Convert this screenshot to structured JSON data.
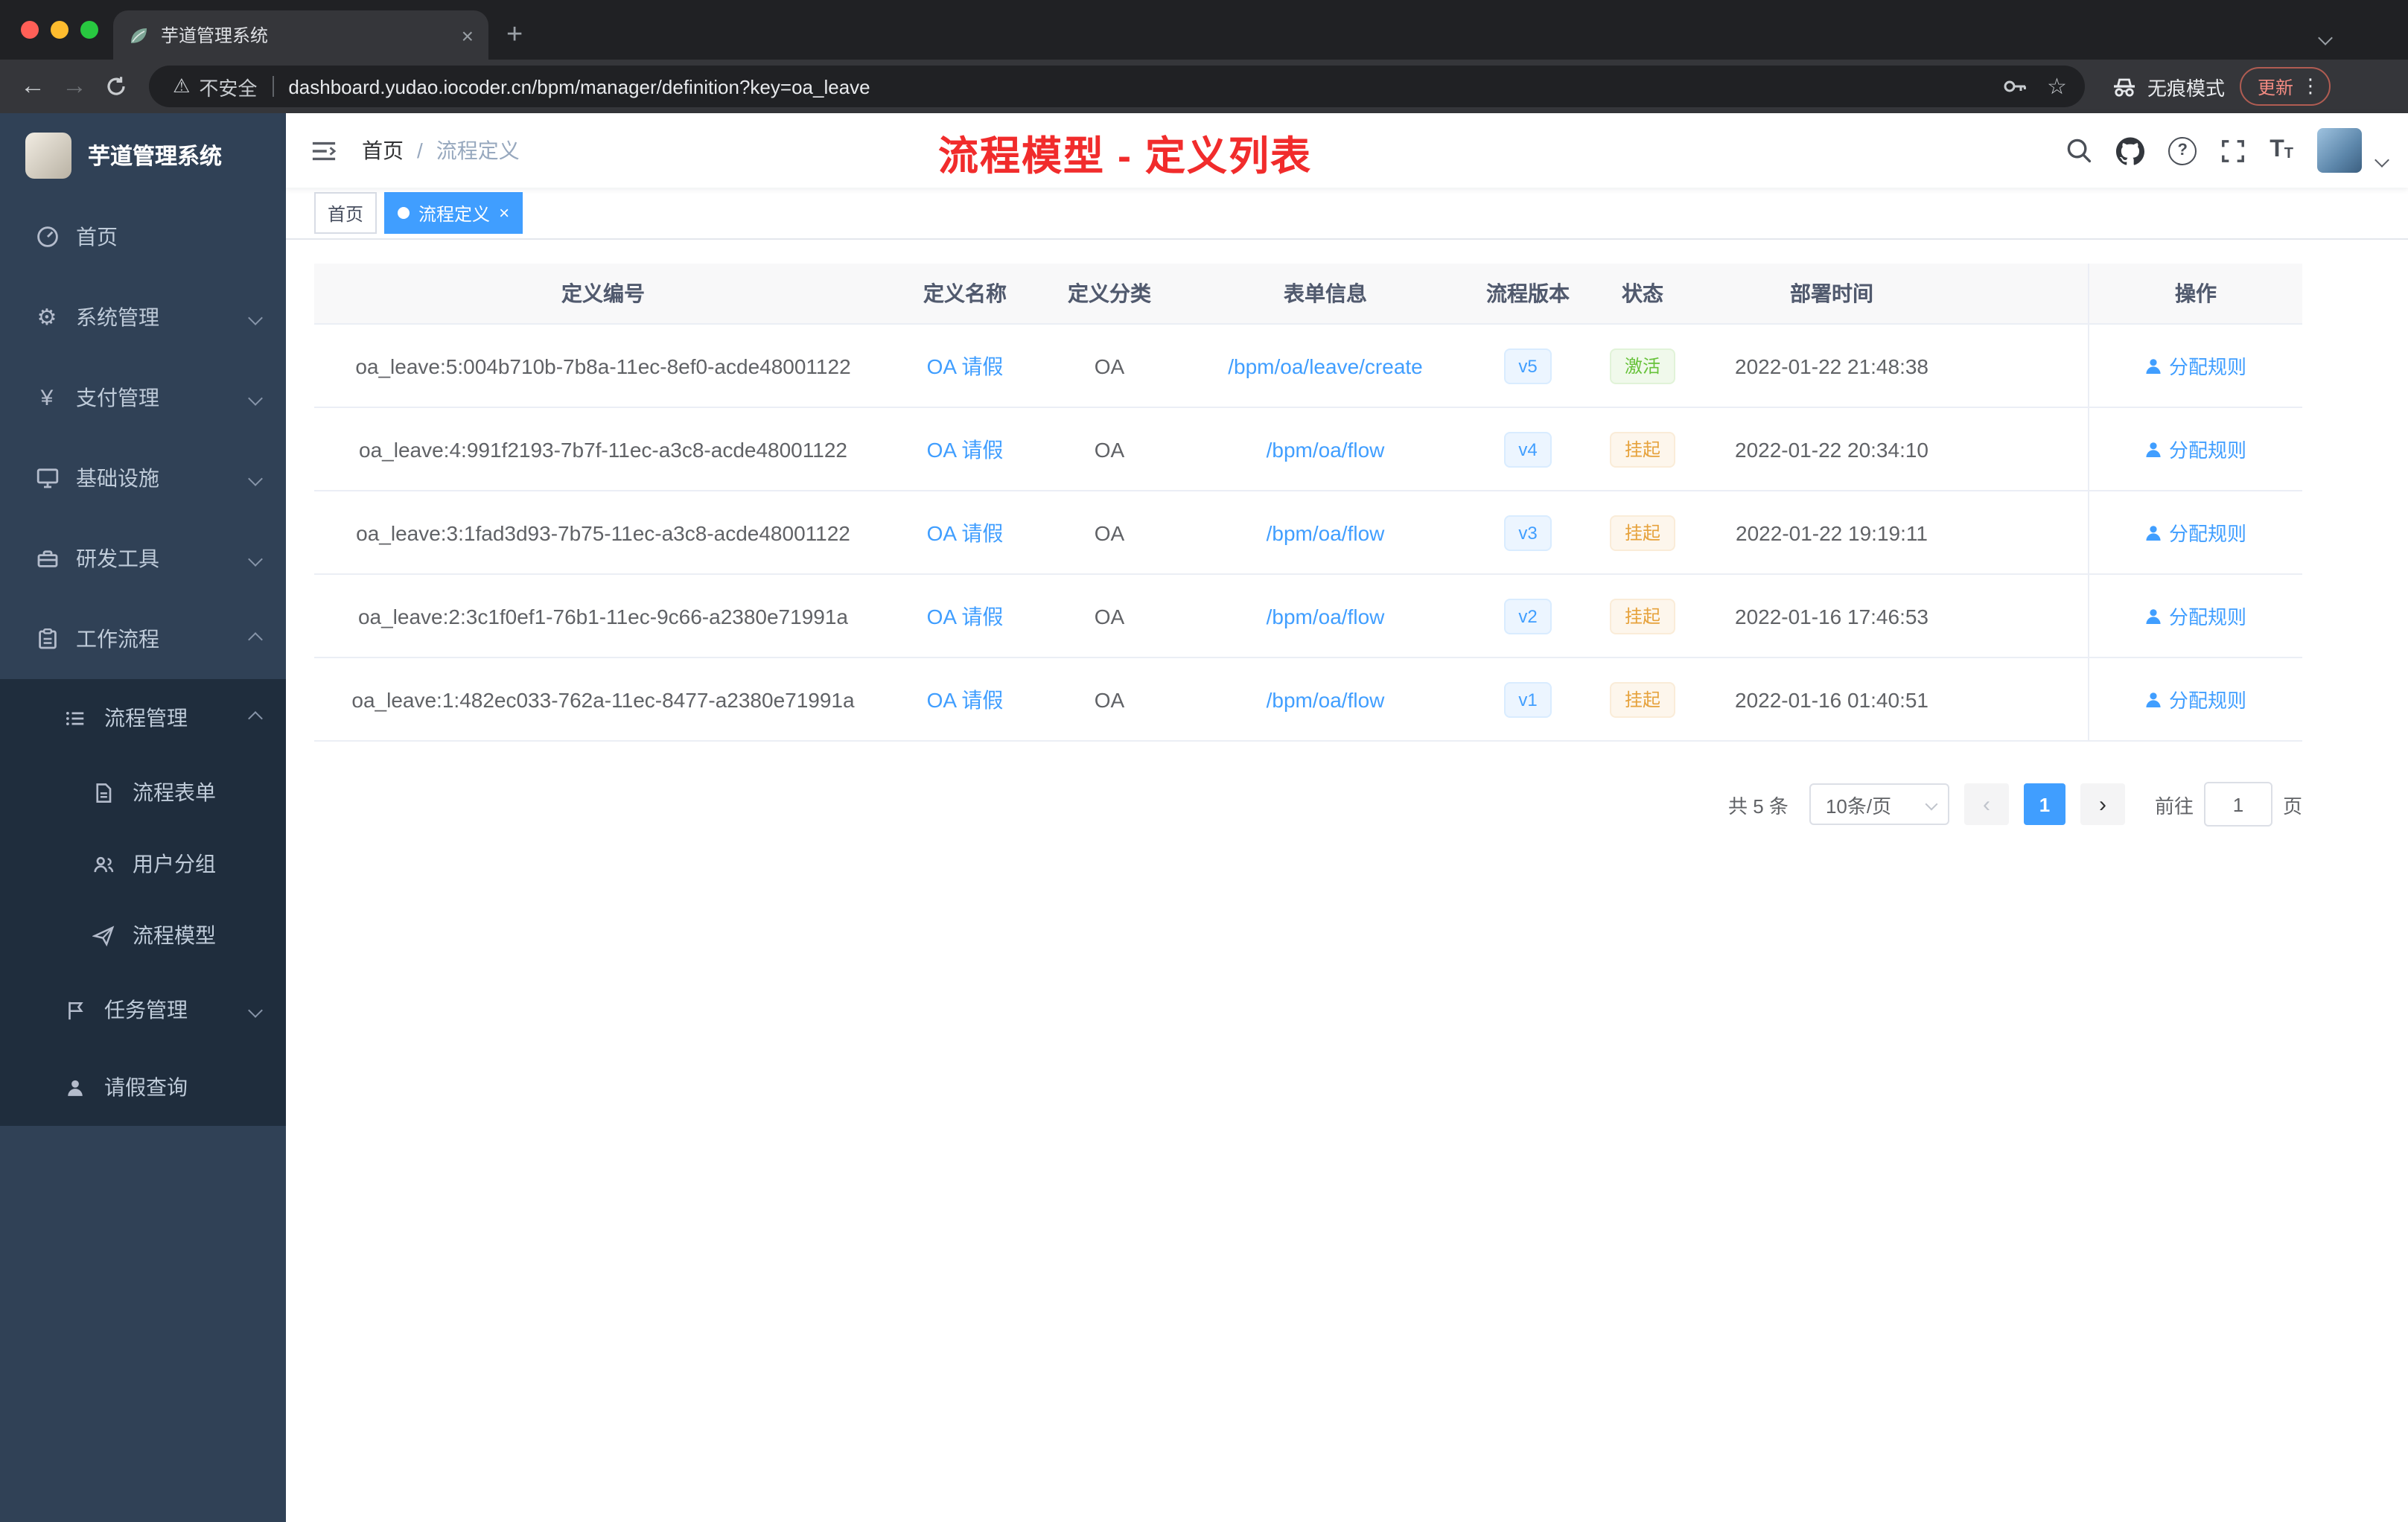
{
  "colors": {
    "primary": "#409eff",
    "annotation_red": "#f12c2c",
    "success_green": "#67c23a",
    "warning_orange": "#e6a23c",
    "sidebar_bg": "#304156",
    "sidebar_submenu_bg": "#1f2d3d",
    "active_tag_bg": "#409eff"
  },
  "icons": {
    "back": "←",
    "forward": "→",
    "star": "☆",
    "warning": "⚠",
    "new_tab": "+",
    "close_tab": "×",
    "menu_dots": "⋮",
    "prev": "‹",
    "next": "›",
    "gear": "⚙",
    "yen": "¥",
    "question": "?",
    "tag_close": "×"
  },
  "browser": {
    "tab_title": "芋道管理系统",
    "security_label": "不安全",
    "url": "dashboard.yudao.iocoder.cn/bpm/manager/definition?key=oa_leave",
    "incognito_label": "无痕模式",
    "update_label": "更新"
  },
  "sidebar": {
    "logo_title": "芋道管理系统",
    "home": "首页",
    "system": "系统管理",
    "payment": "支付管理",
    "infra": "基础设施",
    "devtools": "研发工具",
    "workflow": "工作流程",
    "process_mgmt": "流程管理",
    "process_form": "流程表单",
    "user_group": "用户分组",
    "process_model": "流程模型",
    "task_mgmt": "任务管理",
    "leave_query": "请假查询"
  },
  "header": {
    "breadcrumb_home": "首页",
    "breadcrumb_sep": "/",
    "breadcrumb_current": "流程定义",
    "annotation": "流程模型 - 定义列表"
  },
  "tags": {
    "home": "首页",
    "active": "流程定义"
  },
  "table": {
    "columns": [
      "定义编号",
      "定义名称",
      "定义分类",
      "表单信息",
      "流程版本",
      "状态",
      "部署时间",
      "操作"
    ],
    "rows": [
      {
        "id": "oa_leave:5:004b710b-7b8a-11ec-8ef0-acde48001122",
        "name": "OA 请假",
        "category": "OA",
        "form": "/bpm/oa/leave/create",
        "version": "v5",
        "status": "激活",
        "deploy_time": "2022-01-22 21:48:38",
        "action": "分配规则"
      },
      {
        "id": "oa_leave:4:991f2193-7b7f-11ec-a3c8-acde48001122",
        "name": "OA 请假",
        "category": "OA",
        "form": "/bpm/oa/flow",
        "version": "v4",
        "status": "挂起",
        "deploy_time": "2022-01-22 20:34:10",
        "action": "分配规则"
      },
      {
        "id": "oa_leave:3:1fad3d93-7b75-11ec-a3c8-acde48001122",
        "name": "OA 请假",
        "category": "OA",
        "form": "/bpm/oa/flow",
        "version": "v3",
        "status": "挂起",
        "deploy_time": "2022-01-22 19:19:11",
        "action": "分配规则"
      },
      {
        "id": "oa_leave:2:3c1f0ef1-76b1-11ec-9c66-a2380e71991a",
        "name": "OA 请假",
        "category": "OA",
        "form": "/bpm/oa/flow",
        "version": "v2",
        "status": "挂起",
        "deploy_time": "2022-01-16 17:46:53",
        "action": "分配规则"
      },
      {
        "id": "oa_leave:1:482ec033-762a-11ec-8477-a2380e71991a",
        "name": "OA 请假",
        "category": "OA",
        "form": "/bpm/oa/flow",
        "version": "v1",
        "status": "挂起",
        "deploy_time": "2022-01-16 01:40:51",
        "action": "分配规则"
      }
    ]
  },
  "pagination": {
    "total": "共 5 条",
    "page_size": "10条/页",
    "page": "1",
    "goto_label": "前往",
    "page_unit": "页",
    "page_input": "1"
  }
}
